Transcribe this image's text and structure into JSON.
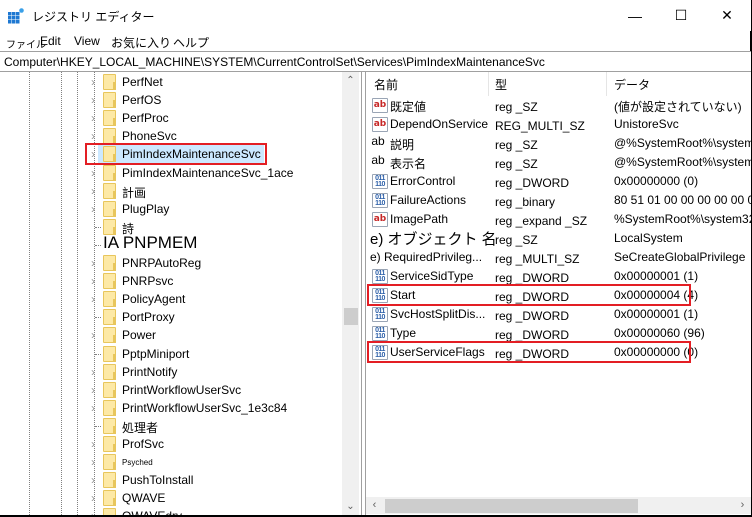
{
  "window": {
    "title": "レジストリ エディター",
    "app_icon": "registry-editor-icon",
    "controls": {
      "minimize": "—",
      "maximize": "☐",
      "close": "✕"
    }
  },
  "menu": [
    "ファイル",
    "Edit",
    "View",
    "お気に入り",
    "ヘルプ"
  ],
  "address": "Computer\\HKEY_LOCAL_MACHINE\\SYSTEM\\CurrentControlSet\\Services\\PimIndexMaintenanceSvc",
  "tree": {
    "items": [
      {
        "label": "PerfNet",
        "expandable": true
      },
      {
        "label": "PerfOS",
        "expandable": true
      },
      {
        "label": "PerfProc",
        "expandable": true
      },
      {
        "label": "PhoneSvc",
        "expandable": true
      },
      {
        "label": "PimIndexMaintenanceSvc",
        "expandable": true,
        "selected": true,
        "highlighted": true
      },
      {
        "label": "PimIndexMaintenanceSvc_1ace",
        "expandable": true
      },
      {
        "label": "計画",
        "expandable": true
      },
      {
        "label": "PlugPlay",
        "expandable": true
      },
      {
        "label": "詩",
        "expandable": false
      },
      {
        "label": "IA PNPMEM",
        "expandable": false
      },
      {
        "label": "PNRPAutoReg",
        "expandable": true
      },
      {
        "label": "PNRPsvc",
        "expandable": true
      },
      {
        "label": "PolicyAgent",
        "expandable": true
      },
      {
        "label": "PortProxy",
        "expandable": false
      },
      {
        "label": "Power",
        "expandable": true
      },
      {
        "label": "PptpMiniport",
        "expandable": false
      },
      {
        "label": "PrintNotify",
        "expandable": true
      },
      {
        "label": "PrintWorkflowUserSvc",
        "expandable": true
      },
      {
        "label": "PrintWorkflowUserSvc_1e3c84",
        "expandable": true
      },
      {
        "label": "処理者",
        "expandable": false
      },
      {
        "label": "ProfSvc",
        "expandable": true
      },
      {
        "label": "Psyched",
        "expandable": true
      },
      {
        "label": "PushToInstall",
        "expandable": true
      },
      {
        "label": "QWAVE",
        "expandable": true
      },
      {
        "label": "QWAVEdrv",
        "expandable": true
      }
    ]
  },
  "list": {
    "columns": [
      "名前",
      "型",
      "データ"
    ],
    "rows": [
      {
        "icon": "ab",
        "name": "既定値",
        "type": "reg _SZ",
        "data": "(値が設定されていない)"
      },
      {
        "icon": "ab",
        "name": "DependOnService",
        "type": "REG_MULTI_SZ",
        "data": "UnistoreSvc"
      },
      {
        "icon": "plain-ab",
        "name": "説明",
        "type": "reg _SZ",
        "data": "@%SystemRoot%\\system"
      },
      {
        "icon": "plain-ab",
        "name": "表示名",
        "type": "reg _SZ",
        "data": "@%SystemRoot%\\system"
      },
      {
        "icon": "bin",
        "name": "ErrorControl",
        "type": "reg _DWORD",
        "data": "0x00000000 (0)"
      },
      {
        "icon": "bin",
        "name": "FailureActions",
        "type": "reg _binary",
        "data": "80 51 01 00 00 00 00 00 0"
      },
      {
        "icon": "ab",
        "name": "ImagePath",
        "type": "reg _expand  _SZ",
        "data": "%SystemRoot%\\system32"
      },
      {
        "icon": "none-big",
        "name": "e) オブジェクト 名",
        "type": "reg _SZ",
        "data": "LocalSystem"
      },
      {
        "icon": "none",
        "name": "e) RequiredPrivileg...",
        "type": "reg _MULTI_SZ",
        "data": "SeCreateGlobalPrivilege"
      },
      {
        "icon": "bin",
        "name": "ServiceSidType",
        "type": "reg _DWORD",
        "data": "0x00000001 (1)"
      },
      {
        "icon": "bin",
        "name": "Start",
        "type": "reg _DWORD",
        "data": "0x00000004 (4)",
        "highlighted": true
      },
      {
        "icon": "bin",
        "name": "SvcHostSplitDis...",
        "type": "reg _DWORD",
        "data": "0x00000001 (1)"
      },
      {
        "icon": "bin",
        "name": "Type",
        "type": "reg _DWORD",
        "data": "0x00000060 (96)"
      },
      {
        "icon": "bin",
        "name": "UserServiceFlags",
        "type": "reg _DWORD",
        "data": "0x00000000 (0)",
        "highlighted": true
      }
    ]
  },
  "icons": {
    "ab_text": "ab",
    "bin_text": "011\n110",
    "chevron": "›",
    "scroll_up": "⌃",
    "scroll_down": "⌄",
    "scroll_left": "‹",
    "scroll_right": "›"
  },
  "colors": {
    "highlight_border": "#e31e24",
    "selection_bg": "#cce8ff",
    "folder_fill": "#fde9a6"
  }
}
